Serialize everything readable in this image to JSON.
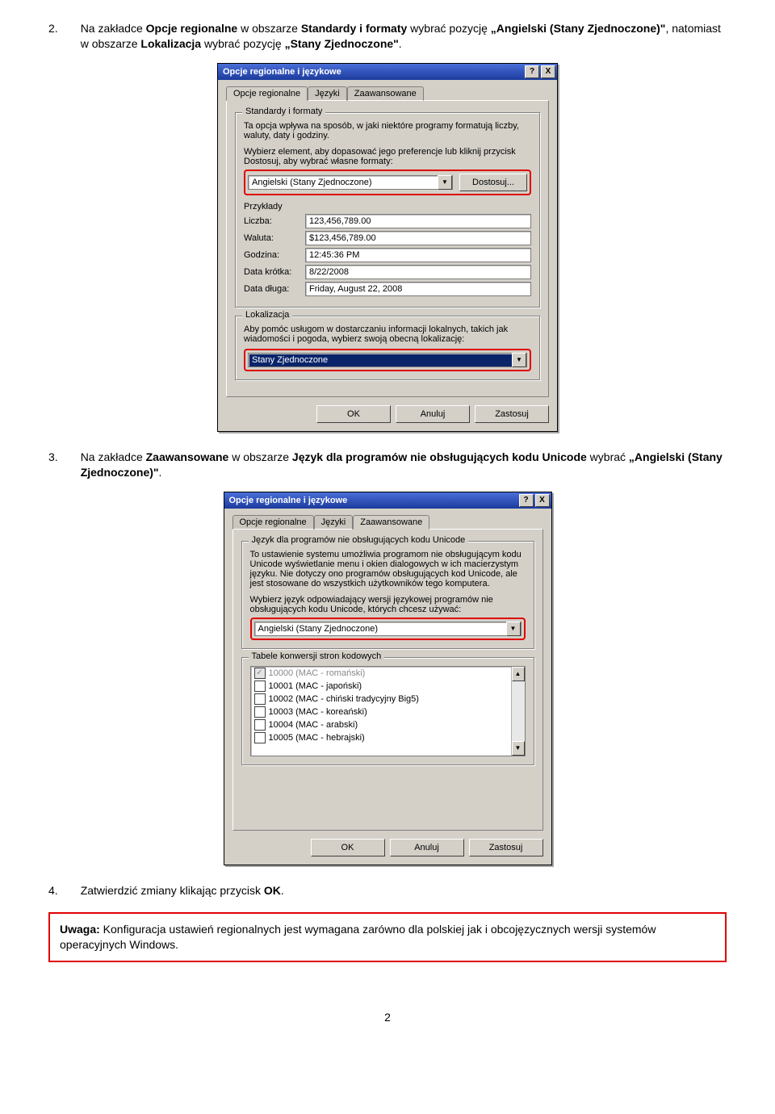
{
  "step2": {
    "num": "2.",
    "pre": "Na zakładce ",
    "t1": "Opcje regionalne",
    "mid1": " w obszarze ",
    "t2": "Standardy i formaty",
    "mid2": " wybrać pozycję ",
    "t3": "„Angielski (Stany Zjednoczone)\"",
    "mid3": ", natomiast w obszarze ",
    "t4": "Lokalizacja",
    "mid4": " wybrać pozycję ",
    "t5": "„Stany Zjednoczone\"",
    "end": "."
  },
  "dialog1": {
    "title": "Opcje regionalne i językowe",
    "help": "?",
    "close": "X",
    "tabs": {
      "t1": "Opcje regionalne",
      "t2": "Języki",
      "t3": "Zaawansowane"
    },
    "group1": {
      "legend": "Standardy i formaty",
      "desc1": "Ta opcja wpływa na sposób, w jaki niektóre programy formatują liczby, waluty, daty i godziny.",
      "desc2": "Wybierz element, aby dopasować jego preferencje lub kliknij przycisk Dostosuj, aby wybrać własne formaty:",
      "select": "Angielski (Stany Zjednoczone)",
      "customize": "Dostosuj...",
      "examples_label": "Przykłady",
      "fields": {
        "number_l": "Liczba:",
        "number_v": "123,456,789.00",
        "currency_l": "Waluta:",
        "currency_v": "$123,456,789.00",
        "time_l": "Godzina:",
        "time_v": "12:45:36 PM",
        "sdate_l": "Data krótka:",
        "sdate_v": "8/22/2008",
        "ldate_l": "Data długa:",
        "ldate_v": "Friday, August 22, 2008"
      }
    },
    "group2": {
      "legend": "Lokalizacja",
      "desc": "Aby pomóc usługom w dostarczaniu informacji lokalnych, takich jak wiadomości i pogoda, wybierz swoją obecną lokalizację:",
      "select": "Stany Zjednoczone"
    },
    "buttons": {
      "ok": "OK",
      "cancel": "Anuluj",
      "apply": "Zastosuj"
    }
  },
  "step3": {
    "num": "3.",
    "pre": "Na zakładce ",
    "t1": "Zaawansowane",
    "mid1": " w obszarze ",
    "t2": "Język dla programów nie obsługujących kodu Unicode",
    "mid2": " wybrać ",
    "t3": "„Angielski (Stany Zjednoczone)\"",
    "end": "."
  },
  "dialog2": {
    "title": "Opcje regionalne i językowe",
    "tabs": {
      "t1": "Opcje regionalne",
      "t2": "Języki",
      "t3": "Zaawansowane"
    },
    "group1": {
      "legend": "Język dla programów nie obsługujących kodu Unicode",
      "desc1": "To ustawienie systemu umożliwia programom nie obsługującym kodu Unicode wyświetlanie menu i okien dialogowych w ich macierzystym języku. Nie dotyczy ono programów obsługujących kod Unicode, ale jest stosowane do wszystkich użytkowników tego komputera.",
      "desc2": "Wybierz język odpowiadający wersji językowej programów nie obsługujących kodu Unicode, których chcesz używać:",
      "select": "Angielski (Stany Zjednoczone)"
    },
    "group2": {
      "legend": "Tabele konwersji stron kodowych",
      "items": [
        {
          "code": "10000 (MAC - romański)",
          "checked": true,
          "disabled": true
        },
        {
          "code": "10001 (MAC - japoński)",
          "checked": false,
          "disabled": false
        },
        {
          "code": "10002 (MAC - chiński tradycyjny Big5)",
          "checked": false,
          "disabled": false
        },
        {
          "code": "10003 (MAC - koreański)",
          "checked": false,
          "disabled": false
        },
        {
          "code": "10004 (MAC - arabski)",
          "checked": false,
          "disabled": false
        },
        {
          "code": "10005 (MAC - hebrajski)",
          "checked": false,
          "disabled": false
        }
      ]
    },
    "buttons": {
      "ok": "OK",
      "cancel": "Anuluj",
      "apply": "Zastosuj"
    }
  },
  "step4": {
    "num": "4.",
    "text_pre": "Zatwierdzić zmiany klikając przycisk ",
    "t1": "OK",
    "end": "."
  },
  "note": {
    "label": "Uwaga:",
    "text": " Konfiguracja ustawień regionalnych jest wymagana zarówno dla polskiej jak i obcojęzycznych wersji systemów operacyjnych Windows."
  },
  "page": "2"
}
